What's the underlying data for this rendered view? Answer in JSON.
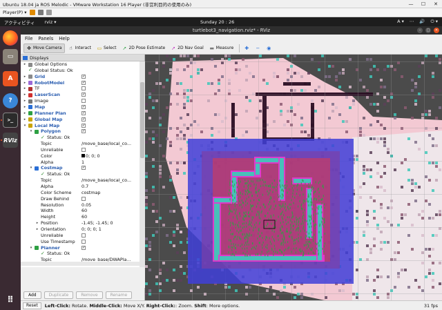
{
  "host": {
    "title": "Ubuntu 18.04 ja ROS Melodic - VMware Workstation 16 Player (非営利目的の使用のみ)",
    "player_menu": "Player(P) ▾",
    "window_controls": [
      "—",
      "☐",
      "✕"
    ]
  },
  "gnome": {
    "activities": "アクティビティ",
    "app_menu": "rviz ▾",
    "clock": "Sunday 20 : 26",
    "indicators": [
      "A ▾",
      "⋯",
      "🔊",
      "⏻ ▾"
    ]
  },
  "dock": {
    "items": [
      {
        "name": "firefox",
        "glyph": ""
      },
      {
        "name": "files",
        "glyph": "▭"
      },
      {
        "name": "software",
        "glyph": "A"
      },
      {
        "name": "help",
        "glyph": "?"
      },
      {
        "name": "terminal",
        "glyph": ">_"
      },
      {
        "name": "rviz",
        "glyph": "RViz"
      },
      {
        "name": "show-apps",
        "glyph": "⠿"
      }
    ]
  },
  "rviz": {
    "title": "turtlebot3_navigation.rviz* - RViz",
    "menus": [
      "File",
      "Panels",
      "Help"
    ],
    "tools": [
      {
        "label": "Move Camera",
        "icon": "move-camera-icon",
        "glyph": "✥",
        "active": true
      },
      {
        "label": "Interact",
        "icon": "interact-icon",
        "glyph": "☝",
        "active": false
      },
      {
        "label": "Select",
        "icon": "select-icon",
        "glyph": "▭",
        "active": false
      },
      {
        "label": "2D Pose Estimate",
        "icon": "pose-estimate-icon",
        "glyph": "➚",
        "active": false
      },
      {
        "label": "2D Nav Goal",
        "icon": "nav-goal-icon",
        "glyph": "➚",
        "active": false
      },
      {
        "label": "Measure",
        "icon": "measure-icon",
        "glyph": "▬",
        "active": false
      }
    ],
    "extra_tools": [
      "✚",
      "−",
      "◉"
    ],
    "panel_title": "Displays",
    "tree": [
      {
        "d": 0,
        "exp": "▸",
        "icon": "gear",
        "label": "Global Options",
        "value": "",
        "chk": null,
        "blue": false
      },
      {
        "d": 0,
        "exp": "",
        "icon": "check",
        "label": "Global Status: Ok",
        "value": "",
        "chk": null,
        "blue": false
      },
      {
        "d": 0,
        "exp": "▸",
        "icon": "grid",
        "label": "Grid",
        "value": "",
        "chk": "✓",
        "blue": true
      },
      {
        "d": 0,
        "exp": "▸",
        "icon": "robot",
        "label": "RobotModel",
        "value": "",
        "chk": "✓",
        "blue": true
      },
      {
        "d": 0,
        "exp": "▸",
        "icon": "tf",
        "label": "TF",
        "value": "",
        "chk": "",
        "blue": false
      },
      {
        "d": 0,
        "exp": "▸",
        "icon": "laser",
        "label": "LaserScan",
        "value": "",
        "chk": "✓",
        "blue": true
      },
      {
        "d": 0,
        "exp": "▸",
        "icon": "image",
        "label": "Image",
        "value": "",
        "chk": "",
        "blue": false
      },
      {
        "d": 0,
        "exp": "▸",
        "icon": "map",
        "label": "Map",
        "value": "",
        "chk": "✓",
        "blue": true
      },
      {
        "d": 0,
        "exp": "▸",
        "icon": "path",
        "label": "Planner Plan",
        "value": "",
        "chk": "✓",
        "blue": true
      },
      {
        "d": 0,
        "exp": "▸",
        "icon": "folder",
        "label": "Global Map",
        "value": "",
        "chk": "✓",
        "blue": true
      },
      {
        "d": 0,
        "exp": "▾",
        "icon": "folder",
        "label": "Local Map",
        "value": "",
        "chk": "✓",
        "blue": true
      },
      {
        "d": 1,
        "exp": "▾",
        "icon": "polygon",
        "label": "Polygon",
        "value": "",
        "chk": "✓",
        "blue": true
      },
      {
        "d": 2,
        "exp": "",
        "icon": "check",
        "label": "Status: Ok",
        "value": "",
        "chk": null,
        "blue": false
      },
      {
        "d": 2,
        "exp": "",
        "icon": "",
        "label": "Topic",
        "value": "/move_base/local_co...",
        "chk": null,
        "blue": false
      },
      {
        "d": 2,
        "exp": "",
        "icon": "",
        "label": "Unreliable",
        "value": "",
        "chk": "",
        "blue": false
      },
      {
        "d": 2,
        "exp": "",
        "icon": "",
        "label": "Color",
        "value": "0; 0; 0",
        "chk": null,
        "blue": false,
        "swatch": true
      },
      {
        "d": 2,
        "exp": "",
        "icon": "",
        "label": "Alpha",
        "value": "1",
        "chk": null,
        "blue": false
      },
      {
        "d": 1,
        "exp": "▾",
        "icon": "map",
        "label": "Costmap",
        "value": "",
        "chk": "✓",
        "blue": true
      },
      {
        "d": 2,
        "exp": "",
        "icon": "check",
        "label": "Status: Ok",
        "value": "",
        "chk": null,
        "blue": false
      },
      {
        "d": 2,
        "exp": "",
        "icon": "",
        "label": "Topic",
        "value": "/move_base/local_co...",
        "chk": null,
        "blue": false
      },
      {
        "d": 2,
        "exp": "",
        "icon": "",
        "label": "Alpha",
        "value": "0.7",
        "chk": null,
        "blue": false
      },
      {
        "d": 2,
        "exp": "",
        "icon": "",
        "label": "Color Scheme",
        "value": "costmap",
        "chk": null,
        "blue": false
      },
      {
        "d": 2,
        "exp": "",
        "icon": "",
        "label": "Draw Behind",
        "value": "",
        "chk": "",
        "blue": false
      },
      {
        "d": 2,
        "exp": "",
        "icon": "",
        "label": "Resolution",
        "value": "0.05",
        "chk": null,
        "blue": false
      },
      {
        "d": 2,
        "exp": "",
        "icon": "",
        "label": "Width",
        "value": "60",
        "chk": null,
        "blue": false
      },
      {
        "d": 2,
        "exp": "",
        "icon": "",
        "label": "Height",
        "value": "60",
        "chk": null,
        "blue": false
      },
      {
        "d": 2,
        "exp": "▸",
        "icon": "",
        "label": "Position",
        "value": "-1.45; -1.45; 0",
        "chk": null,
        "blue": false
      },
      {
        "d": 2,
        "exp": "▸",
        "icon": "",
        "label": "Orientation",
        "value": "0; 0; 0; 1",
        "chk": null,
        "blue": false
      },
      {
        "d": 2,
        "exp": "",
        "icon": "",
        "label": "Unreliable",
        "value": "",
        "chk": "",
        "blue": false
      },
      {
        "d": 2,
        "exp": "",
        "icon": "",
        "label": "Use Timestamp",
        "value": "",
        "chk": "",
        "blue": false
      },
      {
        "d": 1,
        "exp": "▾",
        "icon": "path",
        "label": "Planner",
        "value": "",
        "chk": "✓",
        "blue": true
      },
      {
        "d": 2,
        "exp": "",
        "icon": "check",
        "label": "Status: Ok",
        "value": "",
        "chk": null,
        "blue": false
      },
      {
        "d": 2,
        "exp": "",
        "icon": "",
        "label": "Topic",
        "value": "/move_base/DWAPla...",
        "chk": null,
        "blue": false
      }
    ],
    "buttons": [
      {
        "label": "Add",
        "enabled": true
      },
      {
        "label": "Duplicate",
        "enabled": false
      },
      {
        "label": "Remove",
        "enabled": false
      },
      {
        "label": "Rename",
        "enabled": false
      }
    ],
    "status": {
      "reset": "Reset",
      "hint": [
        {
          "b": "Left-Click:",
          "t": " Rotate. "
        },
        {
          "b": "Middle-Click:",
          "t": " Move X/Y. "
        },
        {
          "b": "Right-Click:",
          "t": ": Zoom. "
        },
        {
          "b": "Shift",
          "t": ": More options."
        }
      ],
      "fps": "31 fps"
    }
  },
  "colors": {
    "ubuntu_orange": "#e95420",
    "tree_blue": "#2a5db0",
    "costmap_blue": "#3f3fd8",
    "costmap_red": "#e0394a",
    "map_pink": "#f3c9d3",
    "obstacle_cyan": "#3fc7b8"
  }
}
